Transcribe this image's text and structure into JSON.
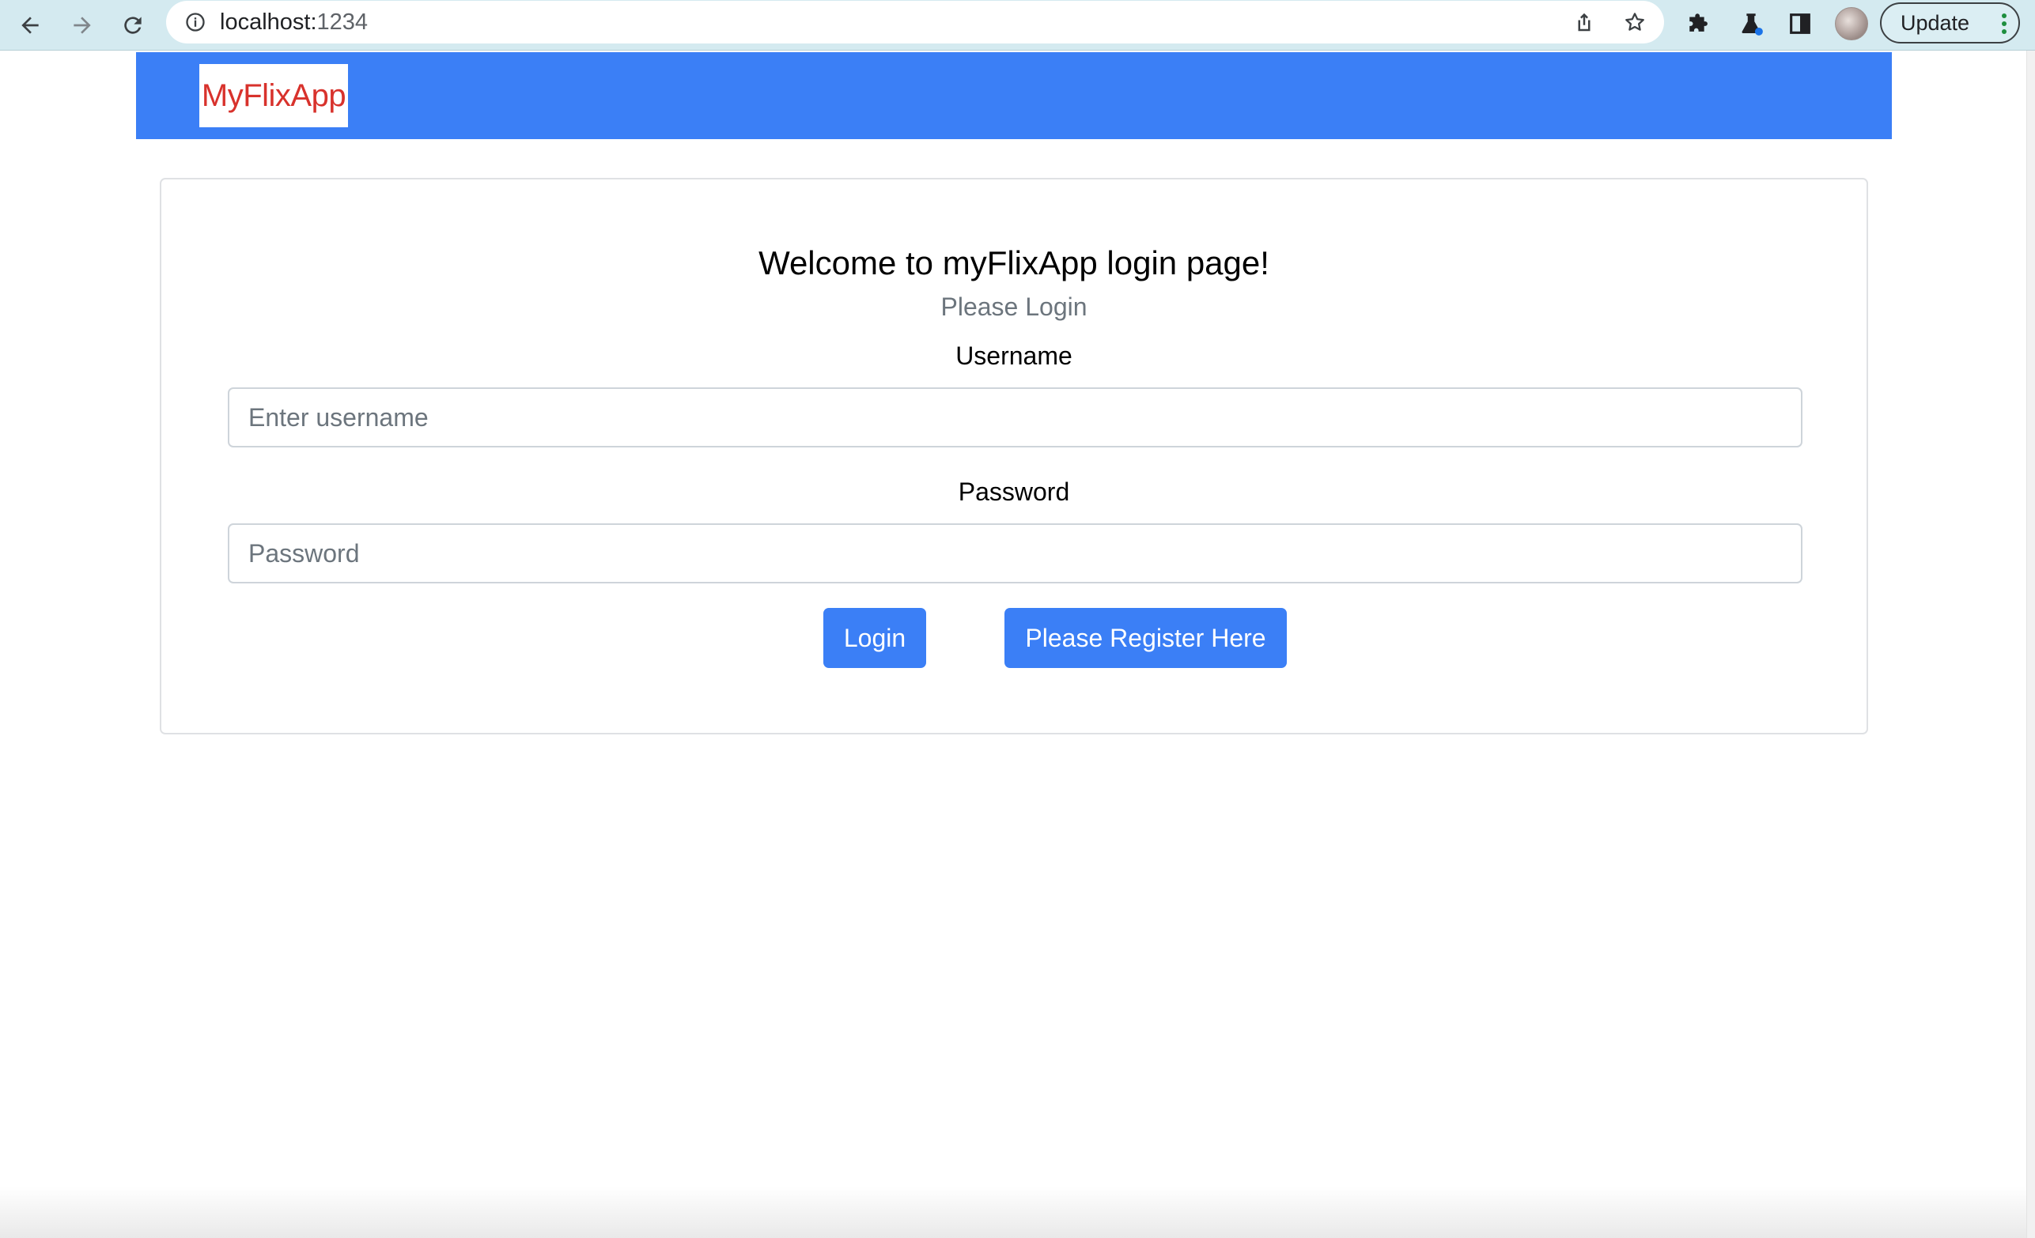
{
  "browser": {
    "url_host": "localhost:",
    "url_port": "1234",
    "update_label": "Update",
    "icons": [
      "back-arrow-icon",
      "forward-arrow-icon",
      "reload-icon",
      "info-icon",
      "share-icon",
      "star-icon",
      "extensions-icon",
      "labs-icon",
      "side-panel-icon",
      "avatar",
      "kebab-menu-icon"
    ]
  },
  "navbar": {
    "brand": "MyFlixApp",
    "background_color": "#3b7ff6",
    "brand_color": "#d8322c"
  },
  "login": {
    "title": "Welcome to myFlixApp login page!",
    "subtitle": "Please Login",
    "username_label": "Username",
    "username_placeholder": "Enter username",
    "username_value": "",
    "password_label": "Password",
    "password_placeholder": "Password",
    "password_value": "",
    "login_button": "Login",
    "register_button": "Please Register Here"
  }
}
